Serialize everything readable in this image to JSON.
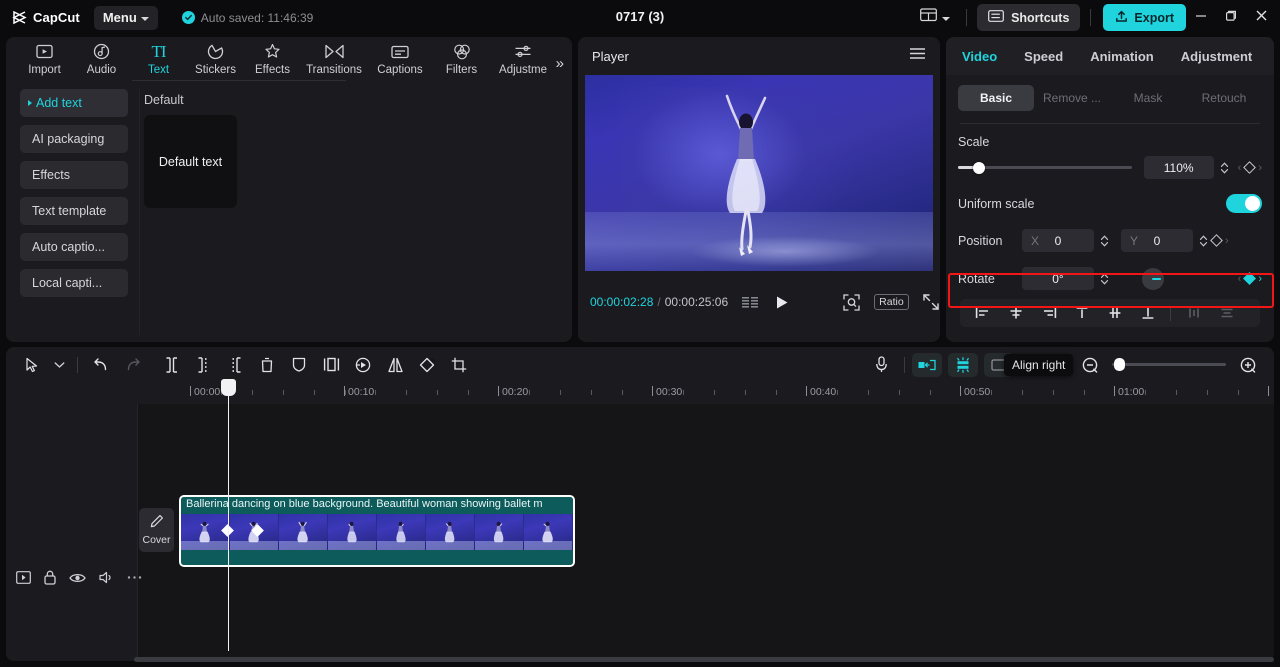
{
  "titlebar": {
    "brand": "CapCut",
    "menu_label": "Menu",
    "autosave_text": "Auto saved: 11:46:39",
    "project_title": "0717 (3)",
    "layout_icon": "layout-icon",
    "shortcuts_label": "Shortcuts",
    "export_label": "Export",
    "minimize_icon": "minimize-icon",
    "maximize_icon": "maximize-icon",
    "close_icon": "close-icon",
    "accent": "#1fd4dd"
  },
  "left_panel": {
    "tabs": [
      {
        "label": "Import",
        "icon": "import-icon",
        "active": false
      },
      {
        "label": "Audio",
        "icon": "audio-icon",
        "active": false
      },
      {
        "label": "Text",
        "icon": "text-icon",
        "active": true
      },
      {
        "label": "Stickers",
        "icon": "stickers-icon",
        "active": false
      },
      {
        "label": "Effects",
        "icon": "effects-icon",
        "active": false
      },
      {
        "label": "Transitions",
        "icon": "transitions-icon",
        "active": false
      },
      {
        "label": "Captions",
        "icon": "captions-icon",
        "active": false
      },
      {
        "label": "Filters",
        "icon": "filters-icon",
        "active": false
      },
      {
        "label": "Adjustme",
        "icon": "adjustment-icon",
        "active": false
      }
    ],
    "more_icon": "chevron-double-right-icon",
    "subnav": [
      {
        "label": "Add text",
        "active": true
      },
      {
        "label": "AI packaging",
        "active": false
      },
      {
        "label": "Effects",
        "active": false
      },
      {
        "label": "Text template",
        "active": false
      },
      {
        "label": "Auto captio...",
        "active": false
      },
      {
        "label": "Local capti...",
        "active": false
      }
    ],
    "section_title": "Default",
    "text_card_label": "Default text"
  },
  "player": {
    "title": "Player",
    "menu_icon": "hamburger-icon",
    "current_time": "00:00:02:28",
    "time_separator": "/",
    "total_time": "00:00:25:06",
    "quality_icon": "quality-icon",
    "play_icon": "play-icon",
    "fit_icon": "fit-to-screen-icon",
    "ratio_label": "Ratio",
    "fullscreen_icon": "fullscreen-icon"
  },
  "right_panel": {
    "tabs": [
      {
        "label": "Video",
        "active": true
      },
      {
        "label": "Speed",
        "active": false
      },
      {
        "label": "Animation",
        "active": false
      },
      {
        "label": "Adjustment",
        "active": false
      }
    ],
    "segments": [
      {
        "label": "Basic",
        "active": true
      },
      {
        "label": "Remove ...",
        "active": false
      },
      {
        "label": "Mask",
        "active": false
      },
      {
        "label": "Retouch",
        "active": false
      }
    ],
    "scale": {
      "label": "Scale",
      "value": "110%",
      "slider_percent": 12,
      "keyframe_state": "empty"
    },
    "uniform_scale": {
      "label": "Uniform scale",
      "enabled": true
    },
    "position": {
      "label": "Position",
      "x_axis": "X",
      "x_value": "0",
      "y_axis": "Y",
      "y_value": "0",
      "keyframe_state": "empty"
    },
    "rotate": {
      "label": "Rotate",
      "value": "0°",
      "dial_icon": "rotation-dial-icon",
      "keyframe_state": "filled",
      "highlighted": true,
      "highlight_color": "#f41616"
    },
    "align_buttons": [
      {
        "icon": "align-left-icon",
        "enabled": true
      },
      {
        "icon": "align-center-horizontal-icon",
        "enabled": true
      },
      {
        "icon": "align-right-icon",
        "enabled": true
      },
      {
        "icon": "align-top-icon",
        "enabled": true
      },
      {
        "icon": "align-middle-vertical-icon",
        "enabled": true
      },
      {
        "icon": "align-bottom-icon",
        "enabled": true
      },
      {
        "icon": "distribute-horizontal-icon",
        "enabled": false
      },
      {
        "icon": "distribute-vertical-icon",
        "enabled": false
      }
    ]
  },
  "timeline": {
    "toolbar_left": [
      {
        "icon": "select-cursor-icon"
      },
      {
        "icon": "chevron-down-icon"
      },
      {
        "icon": "undo-icon"
      },
      {
        "icon": "redo-icon"
      },
      {
        "icon": "split-icon"
      },
      {
        "icon": "trim-left-icon"
      },
      {
        "icon": "trim-right-icon"
      },
      {
        "icon": "delete-icon"
      },
      {
        "icon": "freeze-icon"
      },
      {
        "icon": "picture-in-picture-icon"
      },
      {
        "icon": "reverse-icon"
      },
      {
        "icon": "mirror-icon"
      },
      {
        "icon": "rotate-icon"
      },
      {
        "icon": "crop-icon"
      }
    ],
    "toolbar_right": [
      {
        "icon": "microphone-icon"
      },
      {
        "icon": "snap-magnet-icon",
        "active": true
      },
      {
        "icon": "auto-align-icon",
        "active": true
      },
      {
        "icon": "adjust-clip-icon"
      },
      {
        "icon": "timeline-preview-icon"
      },
      {
        "icon": "zoom-out-icon"
      },
      {
        "icon": "zoom-in-icon"
      }
    ],
    "tooltip": "Align right",
    "zoom_knob_percent": 2,
    "ruler_labels": [
      "00:00",
      "00:10",
      "00:20",
      "00:30",
      "00:40",
      "00:50",
      "01:00"
    ],
    "track_head_icons": [
      {
        "icon": "track-type-icon"
      },
      {
        "icon": "lock-icon"
      },
      {
        "icon": "eye-icon"
      },
      {
        "icon": "speaker-icon"
      },
      {
        "icon": "more-options-icon"
      }
    ],
    "cover_button": {
      "label": "Cover",
      "icon": "edit-pencil-icon"
    },
    "clip": {
      "title": "Ballerina dancing on blue background. Beautiful woman showing ballet m",
      "color": "#0d5b5b",
      "selected": true,
      "keyframes": 2
    },
    "playhead_time": "00:00:02:28"
  }
}
